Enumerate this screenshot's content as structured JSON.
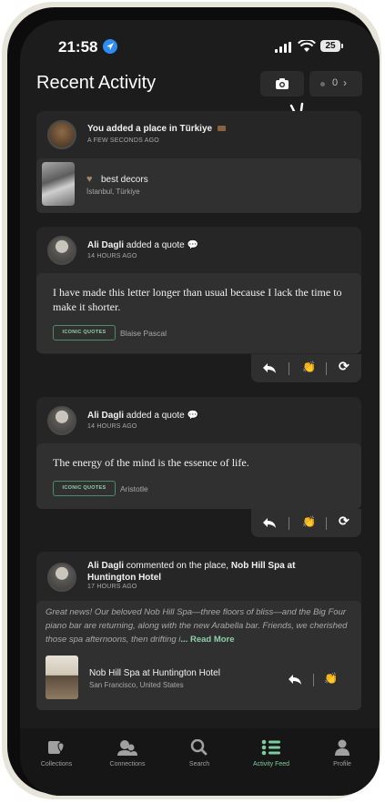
{
  "status": {
    "time": "21:58",
    "battery": "25"
  },
  "header": {
    "title": "Recent Activity",
    "counter": "0"
  },
  "feed": {
    "item1": {
      "text": "You added a place in Türkiye",
      "time": "A FEW SECONDS AGO",
      "place": {
        "name": "best decors",
        "location": "İstanbul, Türkiye"
      }
    },
    "item2": {
      "user": "Ali Dagli",
      "action": "added a quote",
      "time": "14 HOURS AGO",
      "quote": "I have made this letter longer than usual because I lack the time to make it shorter.",
      "tag": "ICONIC QUOTES",
      "author": "Blaise Pascal"
    },
    "item3": {
      "user": "Ali Dagli",
      "action": "added a quote",
      "time": "14 HOURS AGO",
      "quote": "The energy of the mind is the essence of life.",
      "tag": "ICONIC QUOTES",
      "author": "Aristotle"
    },
    "item4": {
      "user": "Ali Dagli",
      "action": "commented on the place,",
      "place_link": "Nob Hill Spa at Huntington Hotel",
      "time": "17 HOURS AGO",
      "comment": "Great news! Our beloved Nob Hill Spa—three floors of bliss—and the Big Four piano bar are returning, along with the new Arabella bar. Friends, we cherished those spa afternoons, then drifting i",
      "read_more": "... Read More",
      "place": {
        "name": "Nob Hill Spa at Huntington Hotel",
        "location": "San Francisco, United States"
      }
    }
  },
  "tabs": [
    {
      "label": "Collections",
      "icon": "collections-icon"
    },
    {
      "label": "Connections",
      "icon": "connections-icon"
    },
    {
      "label": "Search",
      "icon": "search-icon"
    },
    {
      "label": "Activity Feed",
      "icon": "activity-feed-icon",
      "active": true
    },
    {
      "label": "Profile",
      "icon": "profile-icon"
    }
  ],
  "colors": {
    "accent": "#7ccca0",
    "background": "#1c1c1c",
    "card": "#262626"
  }
}
